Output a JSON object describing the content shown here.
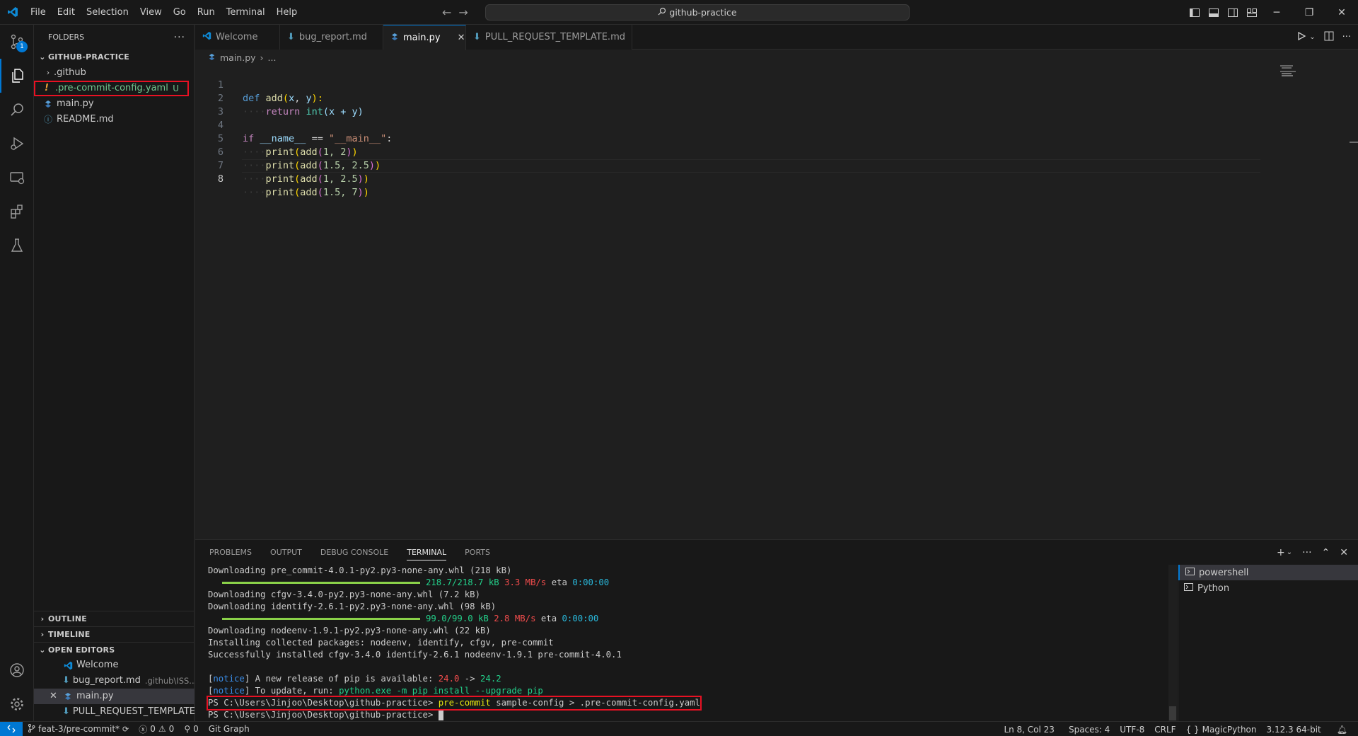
{
  "menu": [
    "File",
    "Edit",
    "Selection",
    "View",
    "Go",
    "Run",
    "Terminal",
    "Help"
  ],
  "command_center": "github-practice",
  "activity": {
    "scm_badge": "1"
  },
  "sidebar": {
    "header": "FOLDERS",
    "folder_name": "GITHUB-PRACTICE",
    "items": [
      {
        "label": ".github"
      },
      {
        "label": ".pre-commit-config.yaml",
        "status": "U",
        "icon": "!"
      },
      {
        "label": "main.py"
      },
      {
        "label": "README.md"
      }
    ],
    "outline": "OUTLINE",
    "timeline": "TIMELINE",
    "open_editors": "OPEN EDITORS",
    "open_items": [
      {
        "label": "Welcome",
        "desc": ""
      },
      {
        "label": "bug_report.md",
        "desc": ".github\\ISS..."
      },
      {
        "label": "main.py",
        "desc": ""
      },
      {
        "label": "PULL_REQUEST_TEMPLATE...",
        "desc": ""
      }
    ]
  },
  "tabs": [
    {
      "label": "Welcome"
    },
    {
      "label": "bug_report.md"
    },
    {
      "label": "main.py"
    },
    {
      "label": "PULL_REQUEST_TEMPLATE.md"
    }
  ],
  "breadcrumb": {
    "file": "main.py",
    "more": "..."
  },
  "code": {
    "line_numbers": [
      "1",
      "2",
      "3",
      "4",
      "5",
      "6",
      "7",
      "8"
    ],
    "lines": [
      {
        "t1": "def",
        "t2": "add",
        "t3": "(",
        "t4": "x",
        "t5": ", ",
        "t6": "y",
        "t7": "):"
      },
      {
        "ind": "····",
        "kw": "return",
        "fn": "int",
        "rest": "(x + y)"
      },
      {},
      {
        "kw": "if",
        "var": "__name__",
        "op": " == ",
        "str": "\"__main__\"",
        "end": ":"
      },
      {
        "ind": "····",
        "fn": "print",
        "a": "(",
        "fn2": "add",
        "b": "(",
        "args": "1, 2",
        "c": ")",
        "d": ")"
      },
      {
        "ind": "····",
        "fn": "print",
        "a": "(",
        "fn2": "add",
        "b": "(",
        "args": "1.5, 2.5",
        "c": ")",
        "d": ")"
      },
      {
        "ind": "····",
        "fn": "print",
        "a": "(",
        "fn2": "add",
        "b": "(",
        "args": "1, 2.5",
        "c": ")",
        "d": ")"
      },
      {
        "ind": "····",
        "fn": "print",
        "a": "(",
        "fn2": "add",
        "b": "(",
        "args": "1.5, 7",
        "c": ")",
        "d": ")"
      }
    ]
  },
  "panel": {
    "tabs": [
      "PROBLEMS",
      "OUTPUT",
      "DEBUG CONSOLE",
      "TERMINAL",
      "PORTS"
    ],
    "terminal": {
      "l1": "Downloading pre_commit-4.0.1-py2.py3-none-any.whl (218 kB)",
      "p1_size": "218.7/218.7 kB",
      "p1_speed": "3.3 MB/s",
      "p1_eta_label": "eta",
      "p1_eta": "0:00:00",
      "l3": "Downloading cfgv-3.4.0-py2.py3-none-any.whl (7.2 kB)",
      "l4": "Downloading identify-2.6.1-py2.py3-none-any.whl (98 kB)",
      "p2_size": "99.0/99.0 kB",
      "p2_speed": "2.8 MB/s",
      "p2_eta_label": "eta",
      "p2_eta": "0:00:00",
      "l6": "Downloading nodeenv-1.9.1-py2.py3-none-any.whl (22 kB)",
      "l7": "Installing collected packages: nodeenv, identify, cfgv, pre-commit",
      "l8": "Successfully installed cfgv-3.4.0 identify-2.6.1 nodeenv-1.9.1 pre-commit-4.0.1",
      "notice_tag": "notice",
      "notice1_text": " A new release of pip is available: ",
      "notice1_old": "24.0",
      "notice1_arrow": " -> ",
      "notice1_new": "24.2",
      "notice2_text": " To update, run: ",
      "notice2_cmd": "python.exe -m pip install --upgrade pip",
      "prompt": "PS C:\\Users\\Jinjoo\\Desktop\\github-practice>",
      "cmd_name": "pre-commit",
      "cmd_args": " sample-config > .pre-commit-config.yaml",
      "prompt2": "PS C:\\Users\\Jinjoo\\Desktop\\github-practice>"
    },
    "terminals": [
      "powershell",
      "Python"
    ]
  },
  "statusbar": {
    "branch": "feat-3/pre-commit*",
    "errors": "0",
    "warnings": "0",
    "ports": "0",
    "git_graph": "Git Graph",
    "position": "Ln 8, Col 23",
    "spaces": "Spaces: 4",
    "encoding": "UTF-8",
    "eol": "CRLF",
    "language": "MagicPython",
    "interpreter": "3.12.3 64-bit"
  },
  "colors": {
    "accent": "#0078d4",
    "highlight": "#e81123",
    "untracked": "#73c991"
  }
}
